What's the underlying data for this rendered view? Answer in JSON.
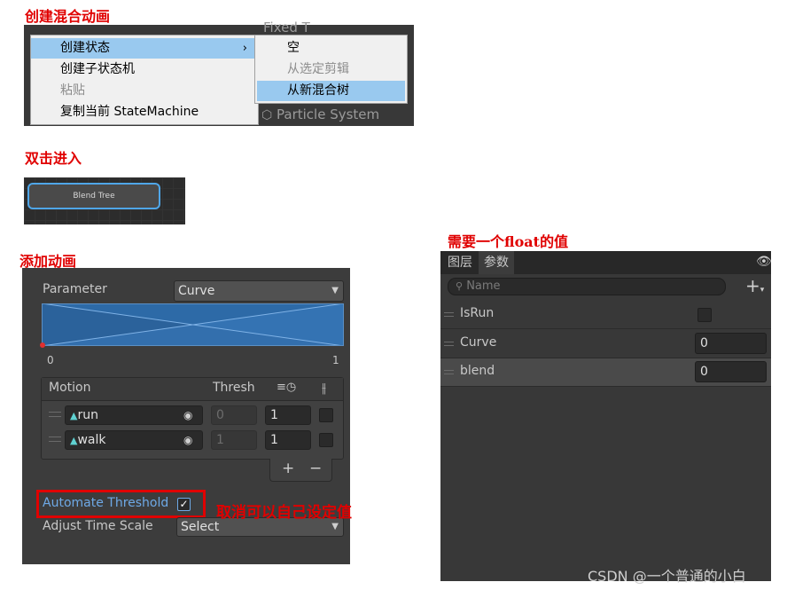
{
  "titles": {
    "create_blend": "创建混合动画",
    "double_click": "双击进入",
    "add_anim": "添加动画",
    "need_float": "需要一个float的值",
    "uncheck_note": "取消可以自己设定值"
  },
  "context_menu": {
    "bg_ghost_top": "Fixed T",
    "bg_ghost_bottom": "Particle System",
    "items": [
      {
        "label": "创建状态",
        "arrow": "›"
      },
      {
        "label": "创建子状态机"
      },
      {
        "label": "粘贴"
      },
      {
        "label": "复制当前 StateMachine"
      }
    ],
    "submenu": [
      {
        "label": "空"
      },
      {
        "label": "从选定剪辑"
      },
      {
        "label": "从新混合树"
      }
    ]
  },
  "node": {
    "label": "Blend Tree"
  },
  "inspector": {
    "parameter_label": "Parameter",
    "parameter_value": "Curve",
    "axis_min": "0",
    "axis_max": "1",
    "col_motion": "Motion",
    "col_thresh": "Thresh",
    "motions": [
      {
        "name": "run",
        "thresh": "0",
        "speed": "1"
      },
      {
        "name": "walk",
        "thresh": "1",
        "speed": "1"
      }
    ],
    "plus": "+",
    "minus": "−",
    "automate_label": "Automate Threshold",
    "adjust_label": "Adjust Time Scale",
    "adjust_value": "Select"
  },
  "params_panel": {
    "tabs": [
      "图层",
      "参数"
    ],
    "search_placeholder": "Name",
    "params": [
      {
        "name": "IsRun",
        "type": "bool"
      },
      {
        "name": "Curve",
        "value": "0"
      },
      {
        "name": "blend",
        "value": "0"
      }
    ]
  },
  "watermark": "CSDN @一个普通的小白"
}
